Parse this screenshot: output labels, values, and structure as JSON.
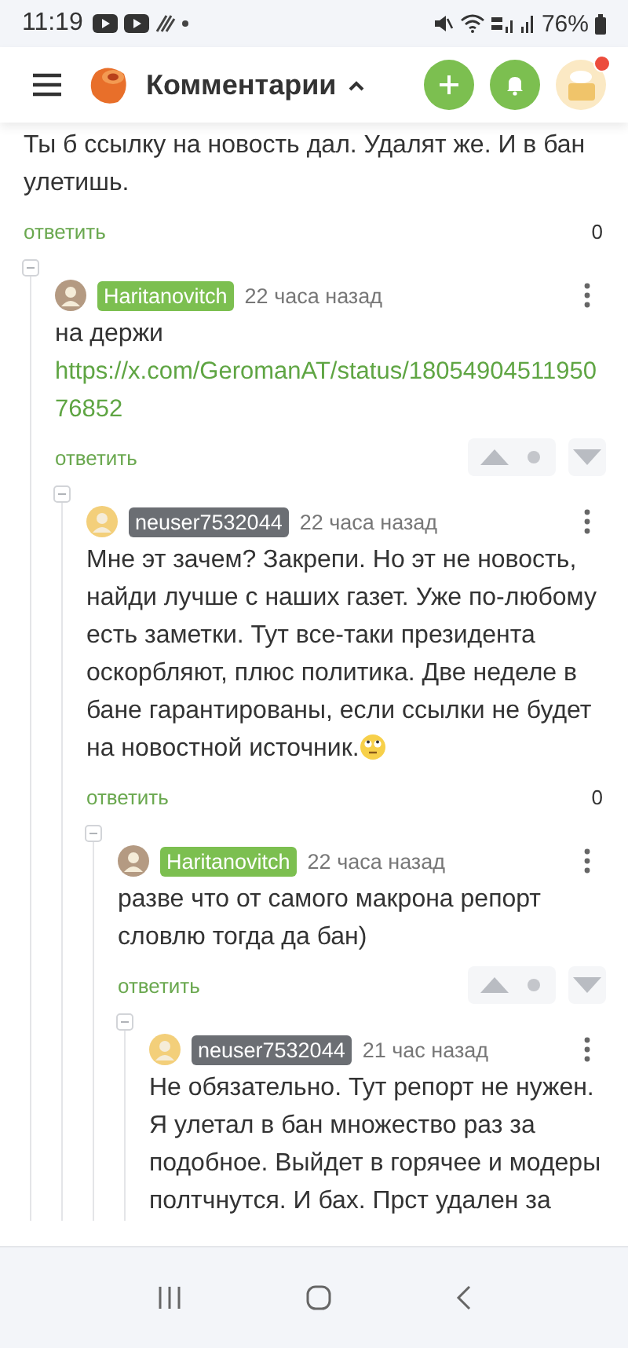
{
  "status_bar": {
    "time": "11:19",
    "battery": "76%"
  },
  "header": {
    "title": "Комментарии",
    "notification": true
  },
  "comments": [
    {
      "text": "Ты б ссылку на новость дал. Удалят же. И в бан улетишь.",
      "emoji": false,
      "reply_label": "ответить",
      "rating": {
        "kind": "score",
        "value": "0"
      },
      "children": [
        {
          "author": "Haritanovitch",
          "color": "#7cbf50",
          "time": "22 часа назад",
          "text": "на держи",
          "link": "https://x.com/GeromanAT/status/1805490451195076852",
          "emoji": false,
          "reply_label": "ответить",
          "rating": {
            "kind": "votes"
          },
          "children": [
            {
              "author": "neuser7532044",
              "color": "#6b6e73",
              "time": "22 часа назад",
              "text": "Мне эт зачем? Закрепи. Но эт не новость, найди лучше с наших газет. Уже по-любому есть заметки. Тут все-таки президента оскорбляют, плюс политика. Две неделе в бане гарантированы, если ссылки не будет на новостной источник.",
              "emoji": true,
              "reply_label": "ответить",
              "rating": {
                "kind": "score",
                "value": "0"
              },
              "children": [
                {
                  "author": "Haritanovitch",
                  "color": "#7cbf50",
                  "time": "22 часа назад",
                  "text": "разве что от самого макрона репорт словлю тогда да бан)",
                  "emoji": false,
                  "reply_label": "ответить",
                  "rating": {
                    "kind": "votes"
                  },
                  "children": [
                    {
                      "author": "neuser7532044",
                      "color": "#6b6e73",
                      "time": "21 час назад",
                      "text": "Не обязательно. Тут репорт не нужен. Я улетал в бан множество раз за подобное. Выйдет в горячее и модеры полтчнутся. И бах. Прст удален за",
                      "emoji": false
                    }
                  ]
                }
              ]
            }
          ]
        }
      ]
    }
  ]
}
